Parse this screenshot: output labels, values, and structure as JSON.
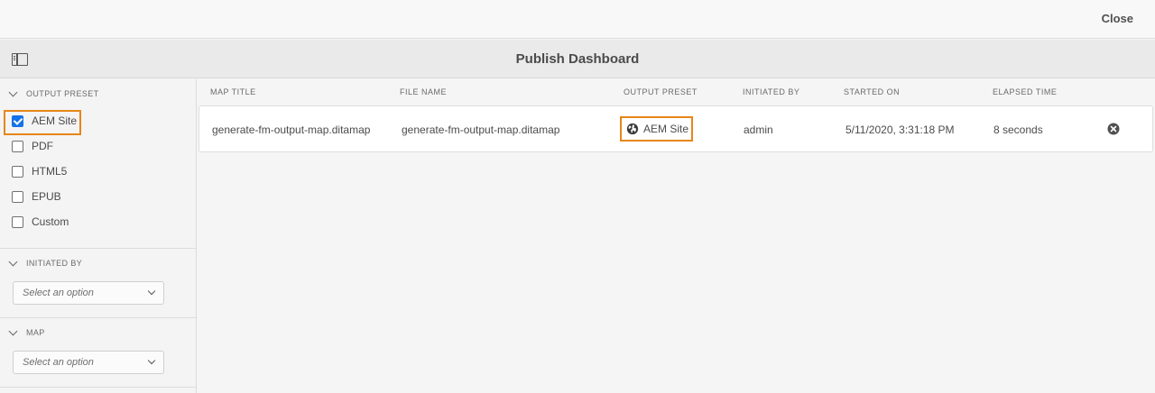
{
  "topbar": {
    "close_label": "Close"
  },
  "header": {
    "title": "Publish Dashboard"
  },
  "filters": {
    "output_preset": {
      "label": "OUTPUT PRESET",
      "options": [
        {
          "label": "AEM Site",
          "checked": true
        },
        {
          "label": "PDF",
          "checked": false
        },
        {
          "label": "HTML5",
          "checked": false
        },
        {
          "label": "EPUB",
          "checked": false
        },
        {
          "label": "Custom",
          "checked": false
        }
      ]
    },
    "initiated_by": {
      "label": "INITIATED BY",
      "placeholder": "Select an option"
    },
    "map": {
      "label": "MAP",
      "placeholder": "Select an option"
    }
  },
  "table": {
    "columns": [
      "MAP TITLE",
      "FILE NAME",
      "OUTPUT PRESET",
      "INITIATED BY",
      "STARTED ON",
      "ELAPSED TIME"
    ],
    "rows": [
      {
        "map_title": "generate-fm-output-map.ditamap",
        "file_name": "generate-fm-output-map.ditamap",
        "output_preset": "AEM Site",
        "initiated_by": "admin",
        "started_on": "5/11/2020, 3:31:18 PM",
        "elapsed_time": "8 seconds"
      }
    ]
  },
  "colors": {
    "accent": "#1473e6",
    "highlight": "#e68619"
  },
  "icons": {
    "rail_toggle": "sidebar-toggle-icon",
    "preset": "globe-icon",
    "cancel": "cancel-circle-icon",
    "section": "chevron-down-icon"
  }
}
